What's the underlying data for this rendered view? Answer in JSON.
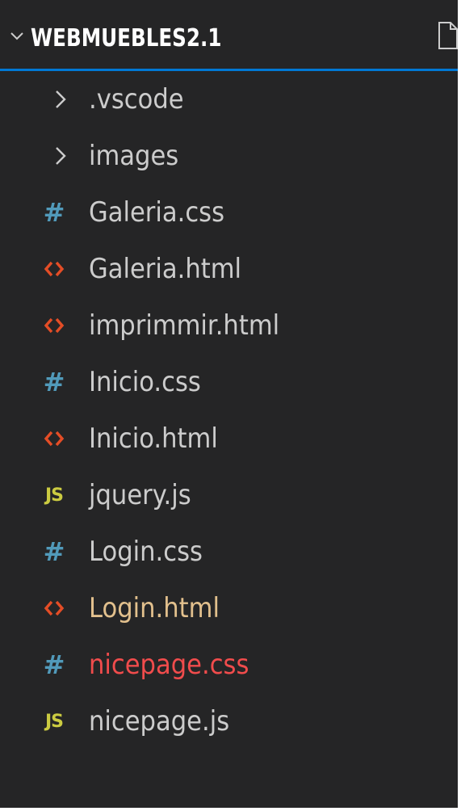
{
  "explorer": {
    "title": "WEBMUEBLES2.1",
    "colors": {
      "background": "#252526",
      "focus_border": "#0078d4",
      "default_text": "#cccccc",
      "modified_text": "#e2c08d",
      "error_text": "#f14c4c",
      "css_icon": "#519aba",
      "html_icon": "#e44d26",
      "js_icon": "#cbcb41"
    },
    "items": [
      {
        "label": ".vscode",
        "type": "folder",
        "icon": "chevron-right-icon"
      },
      {
        "label": "images",
        "type": "folder",
        "icon": "chevron-right-icon"
      },
      {
        "label": "Galeria.css",
        "type": "css",
        "icon": "css-hash-icon"
      },
      {
        "label": "Galeria.html",
        "type": "html",
        "icon": "html-brackets-icon"
      },
      {
        "label": "imprimmir.html",
        "type": "html",
        "icon": "html-brackets-icon"
      },
      {
        "label": "Inicio.css",
        "type": "css",
        "icon": "css-hash-icon"
      },
      {
        "label": "Inicio.html",
        "type": "html",
        "icon": "html-brackets-icon"
      },
      {
        "label": "jquery.js",
        "type": "js",
        "icon": "js-icon"
      },
      {
        "label": "Login.css",
        "type": "css",
        "icon": "css-hash-icon"
      },
      {
        "label": "Login.html",
        "type": "html",
        "icon": "html-brackets-icon",
        "status": "modified"
      },
      {
        "label": "nicepage.css",
        "type": "css",
        "icon": "css-hash-icon",
        "status": "error"
      },
      {
        "label": "nicepage.js",
        "type": "js",
        "icon": "js-icon"
      }
    ],
    "js_icon_text": "JS",
    "css_icon_text": "#"
  }
}
